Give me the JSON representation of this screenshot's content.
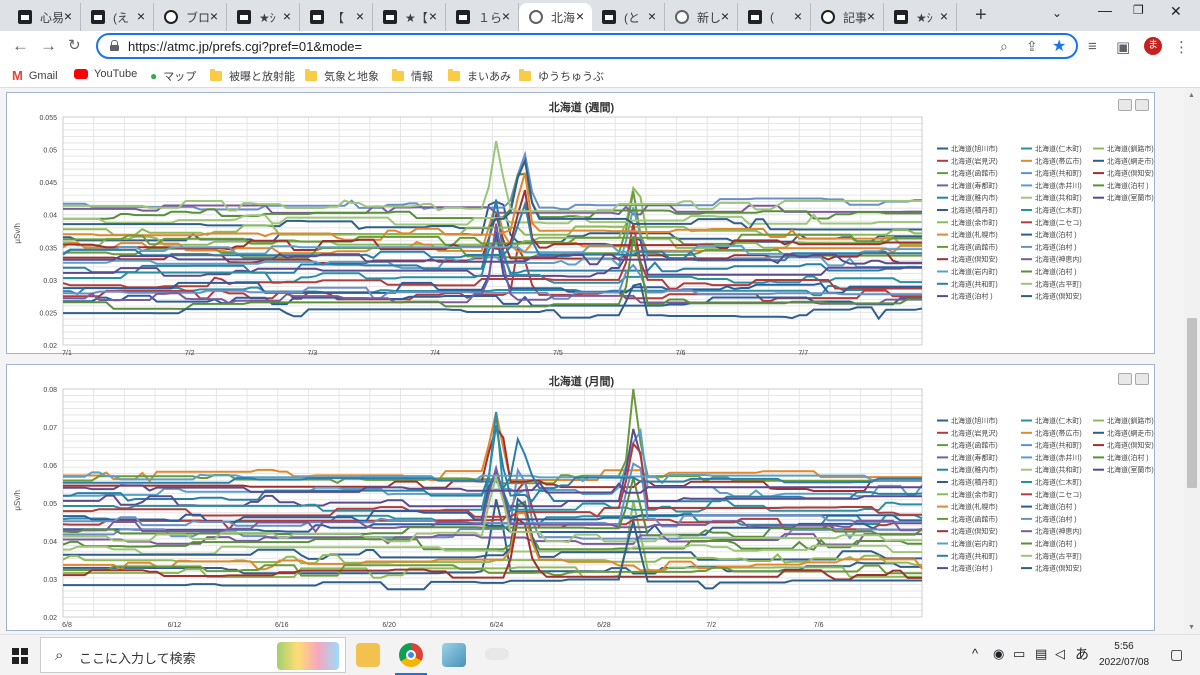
{
  "tabs": [
    {
      "label": "心易",
      "icon": "site-icon"
    },
    {
      "label": "(え",
      "icon": "site-icon"
    },
    {
      "label": "ブロ",
      "icon": "info-icon"
    },
    {
      "label": "★ｼ",
      "icon": "site-icon"
    },
    {
      "label": "【",
      "icon": "site-icon"
    },
    {
      "label": "★【",
      "icon": "site-icon"
    },
    {
      "label": "１ら",
      "icon": "site-icon"
    },
    {
      "label": "北海",
      "icon": "globe-icon",
      "active": true
    },
    {
      "label": "(と",
      "icon": "site-icon"
    },
    {
      "label": "新し",
      "icon": "globe-icon"
    },
    {
      "label": "(",
      "icon": "site-icon"
    },
    {
      "label": "記事",
      "icon": "info-icon"
    },
    {
      "label": "★ｼ",
      "icon": "site-icon"
    }
  ],
  "url": "https://atmc.jp/prefs.cgi?pref=01&mode=",
  "bookmarks": [
    {
      "label": "Gmail",
      "icon": "gmail-icon"
    },
    {
      "label": "YouTube",
      "icon": "youtube-icon"
    },
    {
      "label": "マップ",
      "icon": "maps-icon"
    },
    {
      "label": "被曝と放射能",
      "icon": "folder-icon"
    },
    {
      "label": "気象と地象",
      "icon": "folder-icon"
    },
    {
      "label": "情報",
      "icon": "folder-icon"
    },
    {
      "label": "まいあみ",
      "icon": "folder-icon"
    },
    {
      "label": "ゆうちゅうぶ",
      "icon": "folder-icon"
    }
  ],
  "avatar_letter": "ま",
  "legend": [
    "北海道(旭川市)",
    "北海道(仁木町)",
    "北海道(釧路市)",
    "北海道(岩見沢)",
    "北海道(帯広市)",
    "北海道(網走市)",
    "北海道(函館市)",
    "北海道(共和町)",
    "北海道(倶知安)",
    "北海道(寿都町)",
    "北海道(赤井川)",
    "北海道(泊村 )",
    "北海道(稚内市)",
    "北海道(共和町)",
    "北海道(室蘭市)",
    "北海道(積丹町)",
    "北海道(仁木町)",
    "北海道(余市町)",
    "北海道(ニセコ)",
    "北海道(札幌市)",
    "北海道(泊村 )",
    "北海道(函館市)",
    "北海道(泊村 )",
    "北海道(倶知安)",
    "北海道(神恵内)",
    "北海道(岩内町)",
    "北海道(泊村 )",
    "北海道(共和町)",
    "北海道(古平町)",
    "北海道(泊村 )",
    "北海道(倶知安)"
  ],
  "series_colors": [
    "#2f5f8a",
    "#2a8fa0",
    "#8fbb56",
    "#b23b3b",
    "#e2872e",
    "#2a5c9e",
    "#6a9a3a",
    "#6a8fc7",
    "#a0302f",
    "#7b5a9e",
    "#5aa0c8",
    "#5a8f3a",
    "#2a7fa8",
    "#9ec57a",
    "#5c4a8f"
  ],
  "chart_weekly": {
    "type": "line",
    "title": "北海道 (週間)",
    "ylabel": "μSv/h",
    "ylim": [
      0.02,
      0.055
    ],
    "yticks": [
      "0.055",
      "0.05",
      "0.045",
      "0.04",
      "0.035",
      "0.03",
      "0.025",
      "0.02"
    ],
    "xticks": [
      "7/1",
      "7/2",
      "7/3",
      "7/4",
      "7/5",
      "7/6",
      "7/7"
    ]
  },
  "chart_monthly": {
    "type": "line",
    "title": "北海道 (月間)",
    "ylabel": "μSv/h",
    "ylim": [
      0.02,
      0.08
    ],
    "yticks": [
      "0.08",
      "0.07",
      "0.06",
      "0.05",
      "0.04",
      "0.03",
      "0.02"
    ],
    "xticks": [
      "6/8",
      "6/12",
      "6/16",
      "6/20",
      "6/24",
      "6/28",
      "7/2",
      "7/6"
    ]
  },
  "taskbar": {
    "search_placeholder": "ここに入力して検索",
    "time": "5:56",
    "date": "2022/07/08",
    "ime": "あ"
  }
}
